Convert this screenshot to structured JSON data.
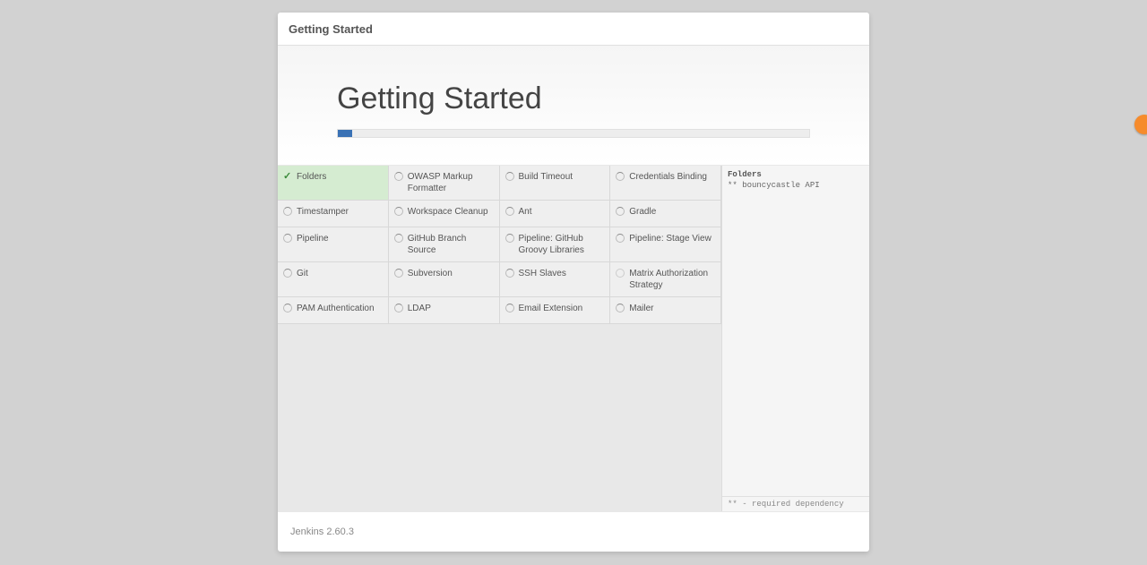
{
  "header": {
    "title": "Getting Started"
  },
  "hero": {
    "heading": "Getting Started",
    "progress_percent": 3
  },
  "plugins": [
    [
      {
        "label": "Folders",
        "status": "done"
      },
      {
        "label": "OWASP Markup Formatter",
        "status": "spin"
      },
      {
        "label": "Build Timeout",
        "status": "spin"
      },
      {
        "label": "Credentials Binding",
        "status": "spin"
      }
    ],
    [
      {
        "label": "Timestamper",
        "status": "spin"
      },
      {
        "label": "Workspace Cleanup",
        "status": "spin"
      },
      {
        "label": "Ant",
        "status": "spin"
      },
      {
        "label": "Gradle",
        "status": "spin"
      }
    ],
    [
      {
        "label": "Pipeline",
        "status": "spin"
      },
      {
        "label": "GitHub Branch Source",
        "status": "spin"
      },
      {
        "label": "Pipeline: GitHub Groovy Libraries",
        "status": "spin"
      },
      {
        "label": "Pipeline: Stage View",
        "status": "spin"
      }
    ],
    [
      {
        "label": "Git",
        "status": "spin"
      },
      {
        "label": "Subversion",
        "status": "spin"
      },
      {
        "label": "SSH Slaves",
        "status": "spin"
      },
      {
        "label": "Matrix Authorization Strategy",
        "status": "pending"
      }
    ],
    [
      {
        "label": "PAM Authentication",
        "status": "spin"
      },
      {
        "label": "LDAP",
        "status": "spin"
      },
      {
        "label": "Email Extension",
        "status": "spin"
      },
      {
        "label": "Mailer",
        "status": "spin"
      }
    ]
  ],
  "log": {
    "title": "Folders",
    "line1": "** bouncycastle API",
    "footer": "** - required dependency"
  },
  "footer": {
    "version": "Jenkins 2.60.3"
  }
}
